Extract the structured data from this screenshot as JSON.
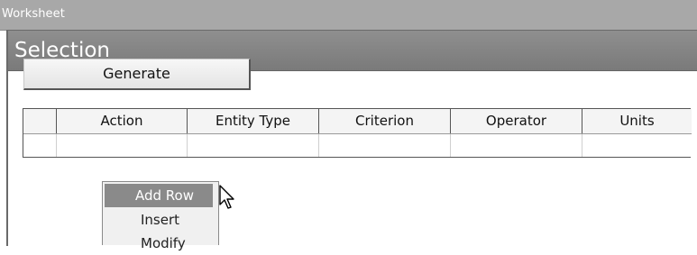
{
  "window": {
    "title": "Worksheet"
  },
  "panel": {
    "title": "Selection"
  },
  "toolbar": {
    "generate_label": "Generate"
  },
  "grid": {
    "columns": [
      "",
      "Action",
      "Entity Type",
      "Criterion",
      "Operator",
      "Units"
    ],
    "rows": [
      [
        "",
        "",
        "",
        "",
        "",
        ""
      ]
    ]
  },
  "context_menu": {
    "items": [
      {
        "label": "Add Row",
        "highlighted": true
      },
      {
        "label": "Insert",
        "highlighted": false
      },
      {
        "label": "Modify",
        "highlighted": false
      }
    ]
  },
  "colors": {
    "title_bar": "#a8a8a8",
    "panel_header": "#808080",
    "menu_highlight": "#8a8a8a"
  }
}
